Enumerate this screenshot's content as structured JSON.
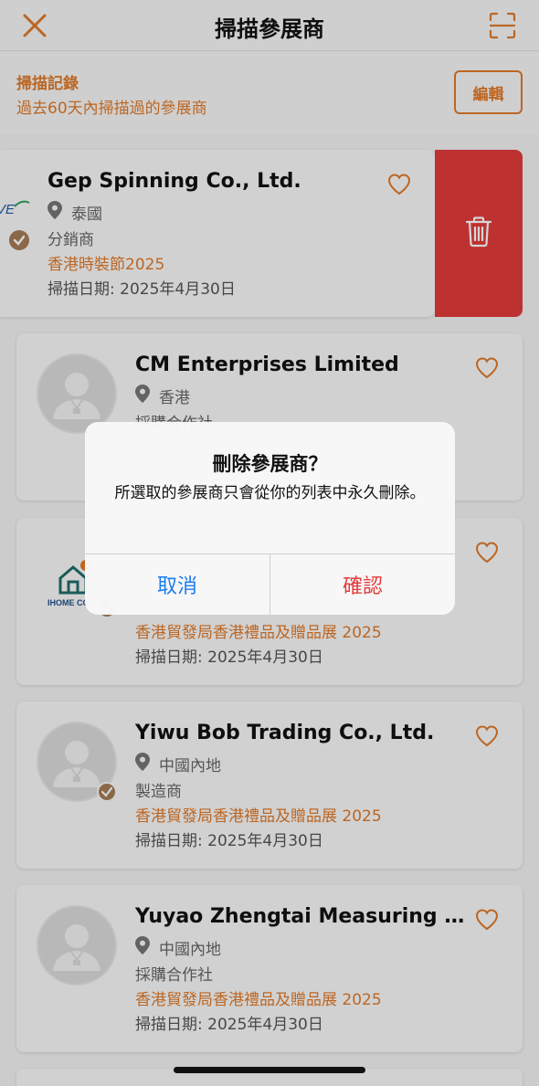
{
  "header": {
    "title": "掃描參展商"
  },
  "history": {
    "title": "掃描記錄",
    "subtitle": "過去60天內掃描過的參展商",
    "edit_label": "編輯"
  },
  "swiped_card": {
    "name": "Gep Spinning Co., Ltd.",
    "location": "泰國",
    "type": "分銷商",
    "event": "香港時裝節2025",
    "date": "掃描日期: 2025年4月30日"
  },
  "cards": [
    {
      "name": "CM Enterprises Limited",
      "location": "香港",
      "type": "採購合作社",
      "event": "",
      "date": ""
    },
    {
      "name": "",
      "location": "",
      "type": "",
      "event": "香港貿發局香港禮品及贈品展 2025",
      "date": "掃描日期: 2025年4月30日",
      "logo_text": "IHOME CON"
    },
    {
      "name": "Yiwu Bob Trading Co., Ltd.",
      "location": "中國內地",
      "type": "製造商",
      "event": "香港貿發局香港禮品及贈品展 2025",
      "date": "掃描日期: 2025年4月30日"
    },
    {
      "name": "Yuyao Zhengtai Measuring Tool...",
      "location": "中國內地",
      "type": "採購合作社",
      "event": "香港貿發局香港禮品及贈品展 2025",
      "date": "掃描日期: 2025年4月30日"
    }
  ],
  "dialog": {
    "title": "刪除參展商？",
    "message": "所選取的參展商只會從你的列表中永久刪除。",
    "cancel_label": "取消",
    "confirm_label": "確認"
  },
  "colors": {
    "accent": "#e07a2a",
    "delete": "#e33b3b",
    "link_blue": "#1a7cf0"
  }
}
